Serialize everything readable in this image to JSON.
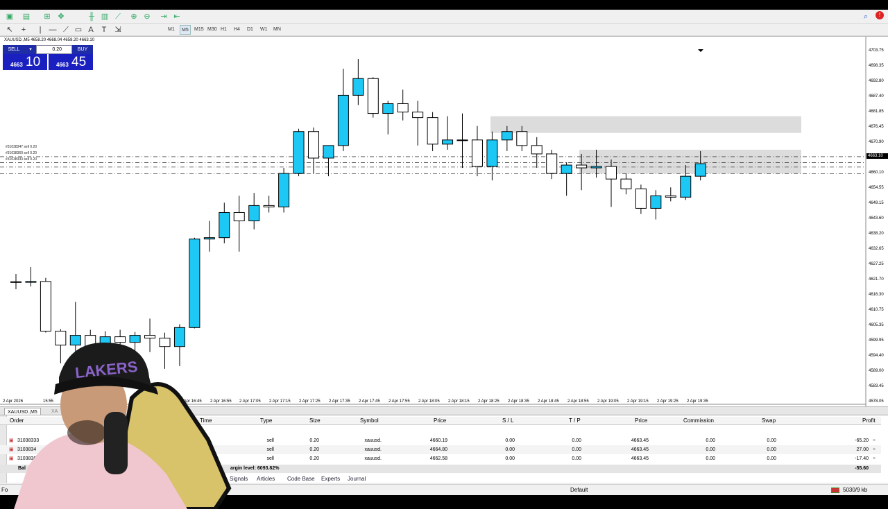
{
  "symbol_info": "XAUUSD.,M5  4658.20 4668.04 4658.20 4663.10",
  "one_click": {
    "sell_label": "SELL",
    "buy_label": "BUY",
    "lots": "0.20",
    "sell_small": "4663",
    "sell_big": "10",
    "buy_small": "4663",
    "buy_big": "45"
  },
  "timeframes": [
    "M1",
    "M5",
    "M15",
    "M30",
    "H1",
    "H4",
    "D1",
    "W1",
    "MN"
  ],
  "active_timeframe": "M5",
  "price_axis": [
    "4703.75",
    "4698.35",
    "4692.80",
    "4687.40",
    "4681.85",
    "4676.45",
    "4670.90",
    "4665.50",
    "4660.10",
    "4654.55",
    "4649.15",
    "4643.60",
    "4638.20",
    "4632.65",
    "4627.25",
    "4621.70",
    "4616.30",
    "4610.75",
    "4605.35",
    "4599.95",
    "4594.40",
    "4589.00",
    "4583.45",
    "4578.05"
  ],
  "current_price": "4663.10",
  "time_axis": [
    "2 Apr 2026",
    "15:55",
    "2 Apr 16:45",
    "2 Apr 16:55",
    "2 Apr 17:05",
    "2 Apr 17:15",
    "2 Apr 17:25",
    "2 Apr 17:35",
    "2 Apr 17:45",
    "2 Apr 17:55",
    "2 Apr 18:05",
    "2 Apr 18:15",
    "2 Apr 18:25",
    "2 Apr 18:35",
    "2 Apr 18:45",
    "2 Apr 18:55",
    "2 Apr 19:05",
    "2 Apr 19:15",
    "2 Apr 19:25",
    "2 Apr 19:35"
  ],
  "order_tags": [
    "#31038347 sell 0.20",
    "#31038360 sell 0.20",
    "#31038333 sell 0.20"
  ],
  "chart_tab": "XAUUSD.,M5",
  "chart_tab2": "XA",
  "terminal": {
    "headers": {
      "order": "Order",
      "time": "Time",
      "type": "Type",
      "size": "Size",
      "symbol": "Symbol",
      "price": "Price",
      "sl": "S / L",
      "tp": "T / P",
      "price2": "Price",
      "commission": "Commission",
      "swap": "Swap",
      "profit": "Profit"
    },
    "rows": [
      {
        "order": "31038333",
        "type": "sell",
        "size": "0.20",
        "symbol": "xauusd.",
        "price": "4660.19",
        "sl": "0.00",
        "tp": "0.00",
        "price2": "4663.45",
        "commission": "0.00",
        "swap": "0.00",
        "profit": "-65.20"
      },
      {
        "order": "3103834",
        "type": "sell",
        "size": "0.20",
        "symbol": "xauusd.",
        "price": "4664.80",
        "sl": "0.00",
        "tp": "0.00",
        "price2": "4663.45",
        "commission": "0.00",
        "swap": "0.00",
        "profit": "27.00"
      },
      {
        "order": "3103836",
        "type": "sell",
        "size": "0.20",
        "symbol": "xauusd.",
        "price": "4662.58",
        "sl": "0.00",
        "tp": "0.00",
        "price2": "4663.45",
        "commission": "0.00",
        "swap": "0.00",
        "profit": "-17.40"
      }
    ],
    "balance_label": "Bal",
    "margin_level": "argin level: 6093.82%",
    "total_profit": "-55.60",
    "tabs": [
      "Signals",
      "Articles",
      "Code Base",
      "Experts",
      "Journal"
    ]
  },
  "status": {
    "profile": "Default",
    "traffic": "5030/9 kb",
    "left": "Fo"
  },
  "colors": {
    "bull": "#1ec8f5",
    "bear": "#ffffff",
    "sell_btn": "#1f2ca8"
  },
  "candles": [
    {
      "o": 4621.2,
      "h": 4624.0,
      "l": 4618.5,
      "c": 4621.0
    },
    {
      "o": 4621.0,
      "h": 4626.5,
      "l": 4619.5,
      "c": 4621.3
    },
    {
      "o": 4621.3,
      "h": 4622.6,
      "l": 4603.0,
      "c": 4603.5
    },
    {
      "o": 4603.5,
      "h": 4604.2,
      "l": 4592.0,
      "c": 4598.5
    },
    {
      "o": 4598.5,
      "h": 4614.0,
      "l": 4595.0,
      "c": 4602.0
    },
    {
      "o": 4602.0,
      "h": 4604.0,
      "l": 4590.0,
      "c": 4594.0
    },
    {
      "o": 4594.0,
      "h": 4603.5,
      "l": 4592.0,
      "c": 4601.5
    },
    {
      "o": 4601.5,
      "h": 4604.0,
      "l": 4597.0,
      "c": 4599.5
    },
    {
      "o": 4599.5,
      "h": 4603.2,
      "l": 4593.0,
      "c": 4602.0
    },
    {
      "o": 4602.0,
      "h": 4608.0,
      "l": 4596.0,
      "c": 4601.0
    },
    {
      "o": 4601.0,
      "h": 4603.0,
      "l": 4590.0,
      "c": 4598.0
    },
    {
      "o": 4598.0,
      "h": 4606.0,
      "l": 4591.0,
      "c": 4604.8
    },
    {
      "o": 4604.8,
      "h": 4637.0,
      "l": 4604.5,
      "c": 4636.5
    },
    {
      "o": 4636.5,
      "h": 4643.0,
      "l": 4632.0,
      "c": 4637.0
    },
    {
      "o": 4637.0,
      "h": 4649.5,
      "l": 4635.0,
      "c": 4646.0
    },
    {
      "o": 4646.0,
      "h": 4652.0,
      "l": 4632.0,
      "c": 4643.0
    },
    {
      "o": 4643.0,
      "h": 4653.0,
      "l": 4640.0,
      "c": 4648.5
    },
    {
      "o": 4648.5,
      "h": 4652.0,
      "l": 4646.0,
      "c": 4648.0
    },
    {
      "o": 4648.0,
      "h": 4662.0,
      "l": 4646.0,
      "c": 4660.0
    },
    {
      "o": 4660.0,
      "h": 4676.0,
      "l": 4659.0,
      "c": 4675.0
    },
    {
      "o": 4675.0,
      "h": 4676.5,
      "l": 4660.0,
      "c": 4665.5
    },
    {
      "o": 4665.5,
      "h": 4670.0,
      "l": 4659.0,
      "c": 4670.0
    },
    {
      "o": 4670.0,
      "h": 4697.5,
      "l": 4668.0,
      "c": 4688.0
    },
    {
      "o": 4688.0,
      "h": 4701.0,
      "l": 4684.5,
      "c": 4694.0
    },
    {
      "o": 4694.0,
      "h": 4694.5,
      "l": 4680.0,
      "c": 4681.5
    },
    {
      "o": 4681.5,
      "h": 4686.0,
      "l": 4674.0,
      "c": 4685.0
    },
    {
      "o": 4685.0,
      "h": 4690.0,
      "l": 4679.0,
      "c": 4682.0
    },
    {
      "o": 4682.0,
      "h": 4686.0,
      "l": 4670.0,
      "c": 4680.0
    },
    {
      "o": 4680.0,
      "h": 4682.0,
      "l": 4668.0,
      "c": 4670.5
    },
    {
      "o": 4670.5,
      "h": 4680.5,
      "l": 4668.5,
      "c": 4672.0
    },
    {
      "o": 4672.0,
      "h": 4681.5,
      "l": 4662.0,
      "c": 4672.0
    },
    {
      "o": 4672.0,
      "h": 4677.0,
      "l": 4659.0,
      "c": 4662.5
    },
    {
      "o": 4662.5,
      "h": 4675.0,
      "l": 4657.5,
      "c": 4672.0
    },
    {
      "o": 4672.0,
      "h": 4677.0,
      "l": 4668.0,
      "c": 4675.0
    },
    {
      "o": 4675.0,
      "h": 4677.0,
      "l": 4668.0,
      "c": 4670.0
    },
    {
      "o": 4670.0,
      "h": 4673.0,
      "l": 4662.0,
      "c": 4667.0
    },
    {
      "o": 4667.0,
      "h": 4668.5,
      "l": 4658.0,
      "c": 4660.0
    },
    {
      "o": 4660.0,
      "h": 4664.0,
      "l": 4652.0,
      "c": 4663.0
    },
    {
      "o": 4663.0,
      "h": 4667.0,
      "l": 4654.0,
      "c": 4662.0
    },
    {
      "o": 4662.0,
      "h": 4668.5,
      "l": 4658.5,
      "c": 4662.5
    },
    {
      "o": 4662.5,
      "h": 4665.0,
      "l": 4648.0,
      "c": 4658.0
    },
    {
      "o": 4658.0,
      "h": 4660.0,
      "l": 4652.5,
      "c": 4654.5
    },
    {
      "o": 4654.5,
      "h": 4656.0,
      "l": 4645.5,
      "c": 4647.5
    },
    {
      "o": 4647.5,
      "h": 4654.0,
      "l": 4643.5,
      "c": 4652.0
    },
    {
      "o": 4652.0,
      "h": 4655.0,
      "l": 4650.0,
      "c": 4651.5
    },
    {
      "o": 4651.5,
      "h": 4663.0,
      "l": 4650.5,
      "c": 4659.0
    },
    {
      "o": 4659.0,
      "h": 4668.0,
      "l": 4657.5,
      "c": 4663.5
    }
  ]
}
